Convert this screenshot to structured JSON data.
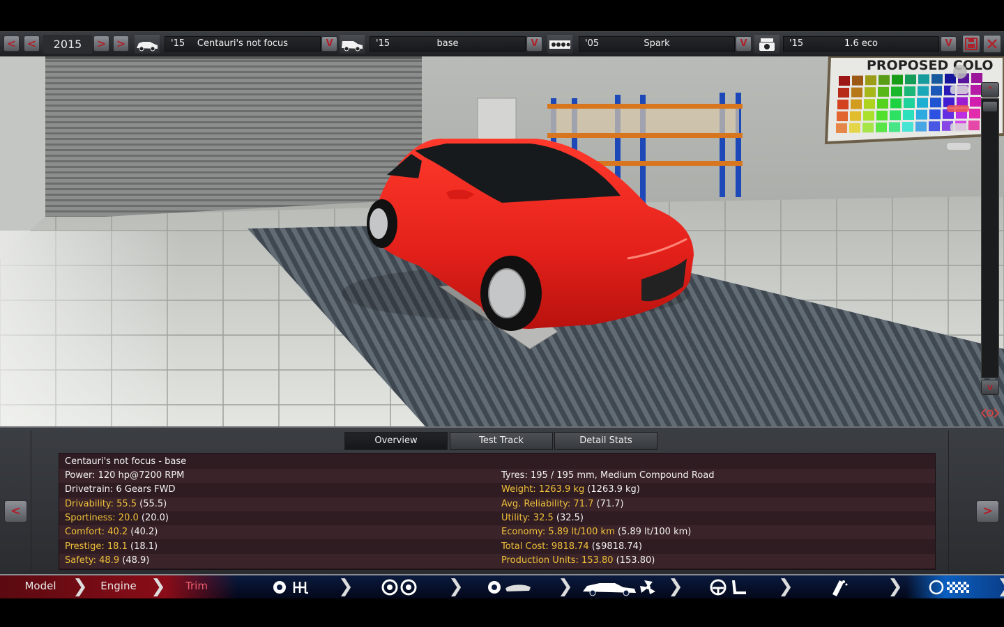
{
  "topbar": {
    "year": "2015",
    "model": {
      "year": "'15",
      "name": "Centauri's not focus"
    },
    "trim": {
      "year": "'15",
      "name": "base"
    },
    "engine": {
      "year": "'05",
      "name": "Spark"
    },
    "variant": {
      "year": "'15",
      "name": "1.6 eco"
    },
    "nav_prev_label": "<",
    "nav_next_label": ">",
    "dropdown_label": "V"
  },
  "viewport": {
    "wall_sign": "PROPOSED COLO",
    "scroll_up": "^",
    "scroll_down": "v"
  },
  "panel": {
    "tabs": [
      "Overview",
      "Test Track",
      "Detail Stats"
    ],
    "prev_label": "<",
    "next_label": ">",
    "title": "Centauri's not focus - base",
    "left": [
      {
        "label": "Power: 120 hp@7200 RPM",
        "extra": ""
      },
      {
        "label": "Drivetrain: 6 Gears FWD",
        "extra": ""
      },
      {
        "label": "Drivability: 55.5",
        "extra": " (55.5)",
        "highlight": true
      },
      {
        "label": "Sportiness: 20.0",
        "extra": " (20.0)",
        "highlight": true
      },
      {
        "label": "Comfort: 40.2",
        "extra": " (40.2)",
        "highlight": true
      },
      {
        "label": "Prestige: 18.1",
        "extra": " (18.1)",
        "highlight": true
      },
      {
        "label": "Safety: 48.9",
        "extra": " (48.9)",
        "highlight": true
      }
    ],
    "right": [
      {
        "label": "Tyres: 195 / 195 mm, Medium Compound Road",
        "extra": ""
      },
      {
        "label": "Weight: 1263.9 kg",
        "extra": " (1263.9 kg)",
        "highlight": true
      },
      {
        "label": "Avg. Reliability: 71.7",
        "extra": " (71.7)",
        "highlight": true
      },
      {
        "label": "Utility: 32.5",
        "extra": " (32.5)",
        "highlight": true
      },
      {
        "label": "Economy: 5.89 lt/100 km",
        "extra": " (5.89 lt/100 km)",
        "highlight": true
      },
      {
        "label": "Total Cost: 9818.74",
        "extra": " ($9818.74)",
        "highlight": true
      },
      {
        "label": "Production Units: 153.80",
        "extra": " (153.80)",
        "highlight": true
      }
    ]
  },
  "bottom_nav": {
    "model": "Model",
    "engine": "Engine",
    "trim": "Trim"
  },
  "colors": {
    "accent_red": "#b0202a",
    "stat_yellow": "#f0c03a",
    "car_red": "#e8201e"
  }
}
